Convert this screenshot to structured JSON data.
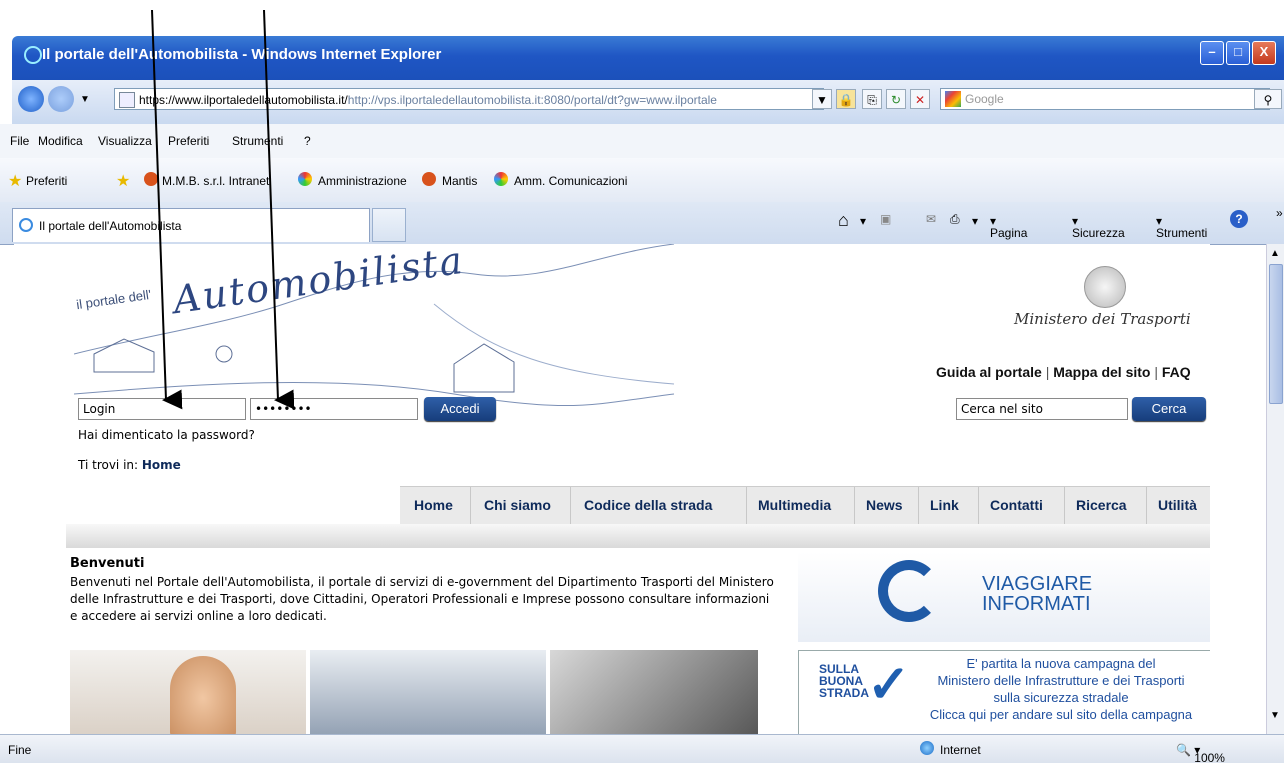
{
  "window": {
    "title": "Il portale dell'Automobilista - Windows Internet Explorer",
    "minimize": "–",
    "maximize": "□",
    "close": "X"
  },
  "address": {
    "url_black": "https://www.ilportaledellautomobilista.it/",
    "url_gray": "http://vps.ilportaledellautomobilista.it:8080/portal/dt?gw=www.ilportale",
    "search_placeholder": "Google"
  },
  "menu": [
    "File",
    "Modifica",
    "Visualizza",
    "Preferiti",
    "Strumenti",
    "?"
  ],
  "favorites": {
    "label": "Preferiti",
    "items": [
      "M.M.B. s.r.l. Intranet",
      "Amministrazione",
      "Mantis",
      "Amm. Comunicazioni"
    ]
  },
  "tab": {
    "title": "Il portale dell'Automobilista"
  },
  "commandbar": {
    "pagina": "Pagina",
    "sicurezza": "Sicurezza",
    "strumenti": "Strumenti"
  },
  "page": {
    "logo_small": "il portale dell'",
    "logo_big": "Automobilista",
    "ministry": "Ministero dei Trasporti",
    "toplinks": [
      "Guida al portale",
      "Mappa del sito",
      "FAQ"
    ],
    "login_value": "Login",
    "password_value": "••••••••",
    "login_button": "Accedi",
    "forgot": "Hai dimenticato la password?",
    "breadcrumb_prefix": "Ti trovi in:",
    "breadcrumb_home": "Home",
    "search_value": "Cerca nel sito",
    "search_button": "Cerca",
    "nav": [
      "Home",
      "Chi siamo",
      "Codice della strada",
      "Multimedia",
      "News",
      "Link",
      "Contatti",
      "Ricerca",
      "Utilità"
    ],
    "welcome_title": "Benvenuti",
    "welcome_text": "Benvenuti nel Portale dell'Automobilista, il portale di servizi di e-government del Dipartimento Trasporti del Ministero delle Infrastrutture e dei Trasporti, dove Cittadini, Operatori Professionali e Imprese possono consultare informazioni e accedere ai servizi online a loro dedicati.",
    "banner1": {
      "line1": "VIAGGIARE",
      "line2": "INFORMATI"
    },
    "banner2": {
      "badge": [
        "SULLA",
        "BUONA",
        "STRADA"
      ],
      "line1": "E' partita la nuova campagna del",
      "line2": "Ministero delle Infrastrutture e dei Trasporti",
      "line3": "sulla sicurezza stradale",
      "line4": "Clicca qui per andare sul sito della campagna"
    }
  },
  "status": {
    "left": "Fine",
    "zone": "Internet",
    "zoom": "100%"
  }
}
